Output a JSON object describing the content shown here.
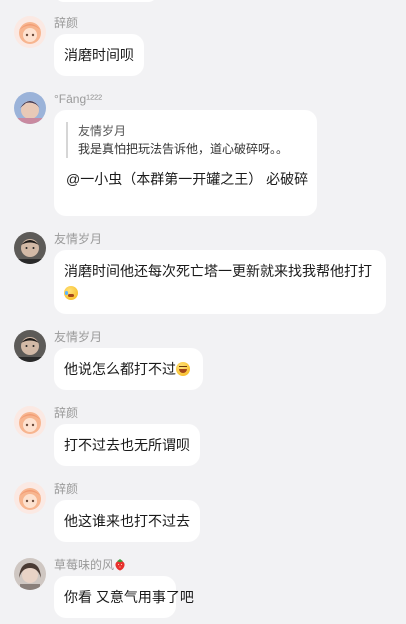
{
  "colors": {
    "background": "#f2f2f4",
    "bubble": "#ffffff",
    "name": "#9a9a9a",
    "text": "#1a1a1a"
  },
  "messages": [
    {
      "sender": "辞颜",
      "avatar": "anime-girl-pink-hair-avatar",
      "text": "消磨时间呗"
    },
    {
      "sender": "°Fāng¹²²²",
      "avatar": "anime-boy-avatar",
      "quote": {
        "author": "友情岁月",
        "text": "我是真怕把玩法告诉他，道心破碎呀。。"
      },
      "text": "@一小虫（本群第一开罐之王） 必破碎"
    },
    {
      "sender": "友情岁月",
      "avatar": "man-photo-avatar",
      "text_line1": "消磨时间他还每次死亡塔一更新就来找我帮他打打",
      "emoji": "crying-laughing-emoji"
    },
    {
      "sender": "友情岁月",
      "avatar": "man-photo-avatar",
      "text": "他说怎么都打不过",
      "emoji": "laughing-sweat-emoji"
    },
    {
      "sender": "辞颜",
      "avatar": "anime-girl-pink-hair-avatar",
      "text": "打不过去也无所谓呗"
    },
    {
      "sender": "辞颜",
      "avatar": "anime-girl-pink-hair-avatar",
      "text": "他这谁来也打不过去"
    },
    {
      "sender": "草莓味的风",
      "sender_icon": "strawberry-icon",
      "avatar": "girl-photo-avatar",
      "text": "你看 又意气用事了吧"
    }
  ]
}
